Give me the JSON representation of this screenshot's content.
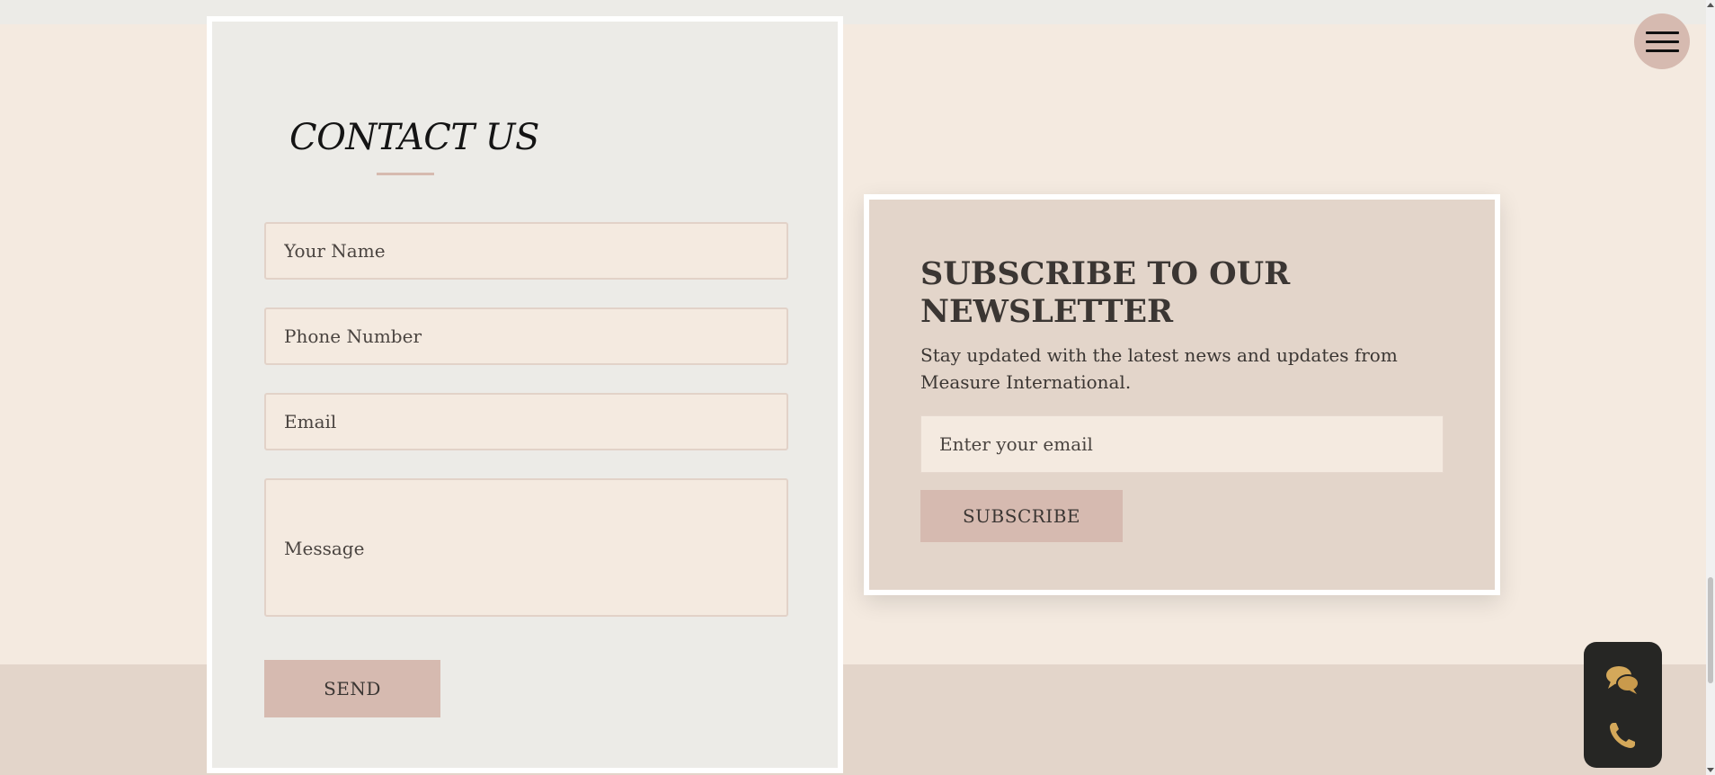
{
  "contact": {
    "title": "CONTACT US",
    "name_placeholder": "Your Name",
    "phone_placeholder": "Phone Number",
    "email_placeholder": "Email",
    "message_placeholder": "Message",
    "send_label": "SEND"
  },
  "newsletter": {
    "title": "SUBSCRIBE TO OUR NEWSLETTER",
    "description": "Stay updated with the latest news and updates from Measure International.",
    "email_placeholder": "Enter your email",
    "subscribe_label": "SUBSCRIBE"
  },
  "icons": {
    "menu": "hamburger-menu-icon",
    "chat": "chat-bubbles-icon",
    "phone": "phone-icon"
  },
  "colors": {
    "page_background": "#f4eae0",
    "card_background": "#ecebe7",
    "accent": "#d6bab0",
    "widget_dark": "#262624",
    "widget_icon_gold": "#d4a85a"
  }
}
